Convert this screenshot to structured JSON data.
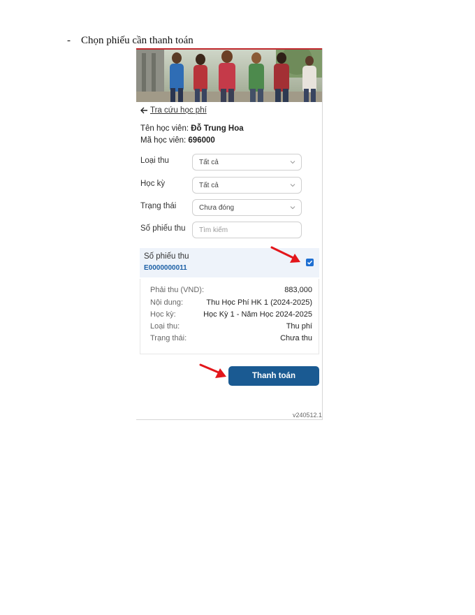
{
  "document": {
    "bullet_dash": "-",
    "bullet_text": "Chọn phiếu cần thanh toán"
  },
  "app": {
    "back_link": "Tra cứu học phí",
    "student": {
      "name_label": "Tên học viên:",
      "name_value": "Đỗ Trung Hoa",
      "id_label": "Mã học viên:",
      "id_value": "696000"
    },
    "filters": [
      {
        "label": "Loại thu",
        "value": "Tất cả"
      },
      {
        "label": "Học kỳ",
        "value": "Tất cả"
      },
      {
        "label": "Trạng thái",
        "value": "Chưa đóng"
      }
    ],
    "receipt_search": {
      "label": "Số phiếu thu",
      "placeholder": "Tìm kiếm"
    },
    "receipt": {
      "header_label": "Số phiếu thu",
      "code": "E0000000011",
      "checked": true,
      "details": [
        {
          "key": "Phải thu (VND):",
          "value": "883,000"
        },
        {
          "key": "Nội dung:",
          "value": "Thu Học Phí HK 1 (2024-2025)"
        },
        {
          "key": "Học kỳ:",
          "value": "Học Kỳ 1 - Năm Học 2024-2025"
        },
        {
          "key": "Loại thu:",
          "value": "Thu phí"
        },
        {
          "key": "Trạng thái:",
          "value": "Chưa thu"
        }
      ]
    },
    "pay_button": "Thanh toán",
    "version": "v240512.1"
  },
  "colors": {
    "primary_button": "#1a5a92",
    "checkbox": "#1e6fd2",
    "receipt_code": "#1b5fa5",
    "annotation_arrow": "#e3161b",
    "banner_border": "#c0282d"
  },
  "icons": {
    "back": "arrow-left-icon",
    "select": "chevron-down-icon",
    "checkbox": "checkmark-icon",
    "annotation": "red-arrow-icon"
  }
}
